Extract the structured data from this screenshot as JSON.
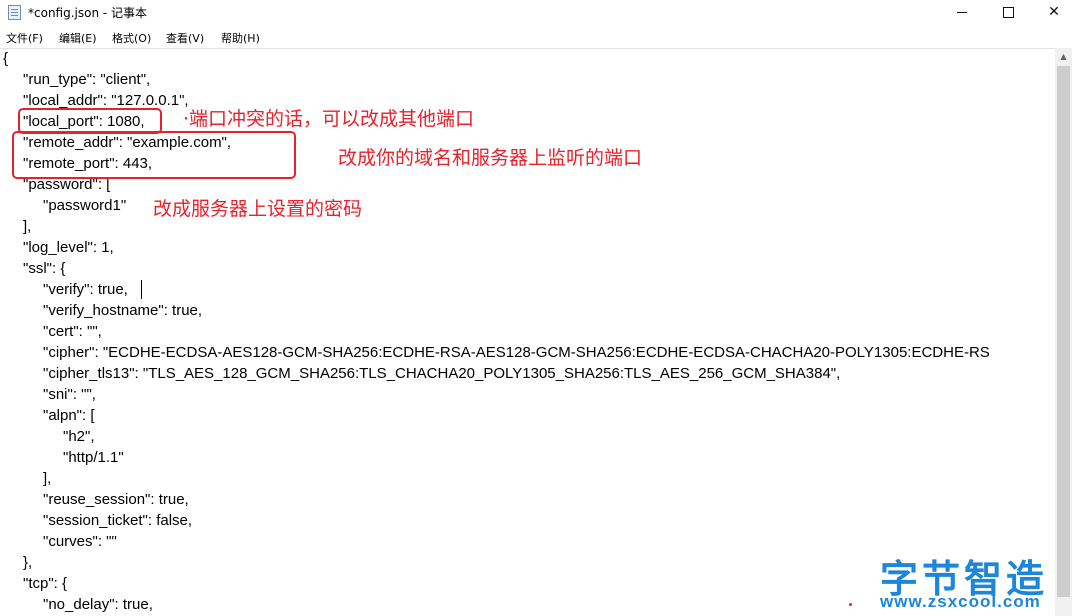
{
  "window": {
    "title": "*config.json - 记事本",
    "icon": "notepad-icon",
    "controls": {
      "minimize": "minimize-icon",
      "maximize": "maximize-icon",
      "close": "✕"
    }
  },
  "menu": {
    "items": [
      "文件(F)",
      "编辑(E)",
      "格式(O)",
      "查看(V)",
      "帮助(H)"
    ]
  },
  "editor": {
    "lines": [
      "{",
      "\"run_type\": \"client\",",
      "\"local_addr\": \"127.0.0.1\",",
      "\"local_port\": 1080,",
      "\"remote_addr\": \"example.com\",",
      "\"remote_port\": 443,",
      "\"password\": [",
      "\"password1\"",
      "],",
      "\"log_level\": 1,",
      "\"ssl\": {",
      "\"verify\": true,",
      "\"verify_hostname\": true,",
      "\"cert\": \"\",",
      "\"cipher\": \"ECDHE-ECDSA-AES128-GCM-SHA256:ECDHE-RSA-AES128-GCM-SHA256:ECDHE-ECDSA-CHACHA20-POLY1305:ECDHE-RS",
      "\"cipher_tls13\": \"TLS_AES_128_GCM_SHA256:TLS_CHACHA20_POLY1305_SHA256:TLS_AES_256_GCM_SHA384\",",
      "\"sni\": \"\",",
      "\"alpn\": [",
      "\"h2\",",
      "\"http/1.1\"",
      "],",
      "\"reuse_session\": true,",
      "\"session_ticket\": false,",
      "\"curves\": \"\"",
      "},",
      "\"tcp\": {",
      "\"no_delay\": true,"
    ]
  },
  "annotations": {
    "port_note": "·端口冲突的话，可以改成其他端口",
    "domain_note": "改成你的域名和服务器上监听的端口",
    "password_note": "改成服务器上设置的密码",
    "color": "#e8212b"
  },
  "watermark": {
    "name": "字节智造",
    "url": "www.zsxcool.com",
    "color": "#1d86d9"
  }
}
